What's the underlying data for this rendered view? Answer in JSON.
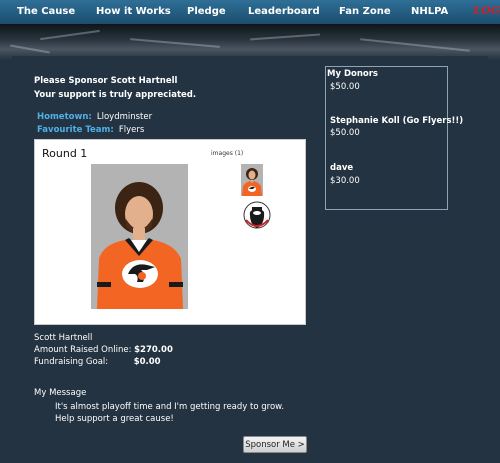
{
  "nav": {
    "items": [
      "The Cause",
      "How it Works",
      "Pledge",
      "Leaderboard",
      "Fan Zone",
      "NHLPA"
    ],
    "logo_text": "LOG"
  },
  "intro": {
    "line1": "Please Sponsor Scott Hartnell",
    "line2": "Your support is truly appreciated."
  },
  "info": {
    "hometown_label": "Hometown:",
    "hometown_value": "Lloydminster",
    "team_label": "Favourite Team:",
    "team_value": "Flyers"
  },
  "gallery": {
    "title": "Round 1",
    "images_count": "images (1)"
  },
  "donors": {
    "title": "My Donors",
    "list": [
      {
        "name": "",
        "amount": "$50.00"
      },
      {
        "name": "Stephanie Koll (Go Flyers!!)",
        "amount": "$50.00"
      },
      {
        "name": "dave",
        "amount": "$30.00"
      }
    ]
  },
  "stats": {
    "player_name": "Scott Hartnell",
    "raised_label": "Amount Raised Online:",
    "raised_value": "$270.00",
    "goal_label": "Fundraising Goal:",
    "goal_value": "$0.00"
  },
  "message": {
    "title": "My Message",
    "body": "It's almost playoff time and I'm getting ready to grow. Help support a great cause!"
  },
  "sponsor_button": "Sponsor Me >",
  "colors": {
    "background": "#233341",
    "nav": "#1b4d6e",
    "accent_label": "#4fb0e8",
    "logo_red": "#d11f26",
    "jersey_orange": "#f26522"
  },
  "icons": [
    "flyers-logo",
    "beard-logo"
  ]
}
